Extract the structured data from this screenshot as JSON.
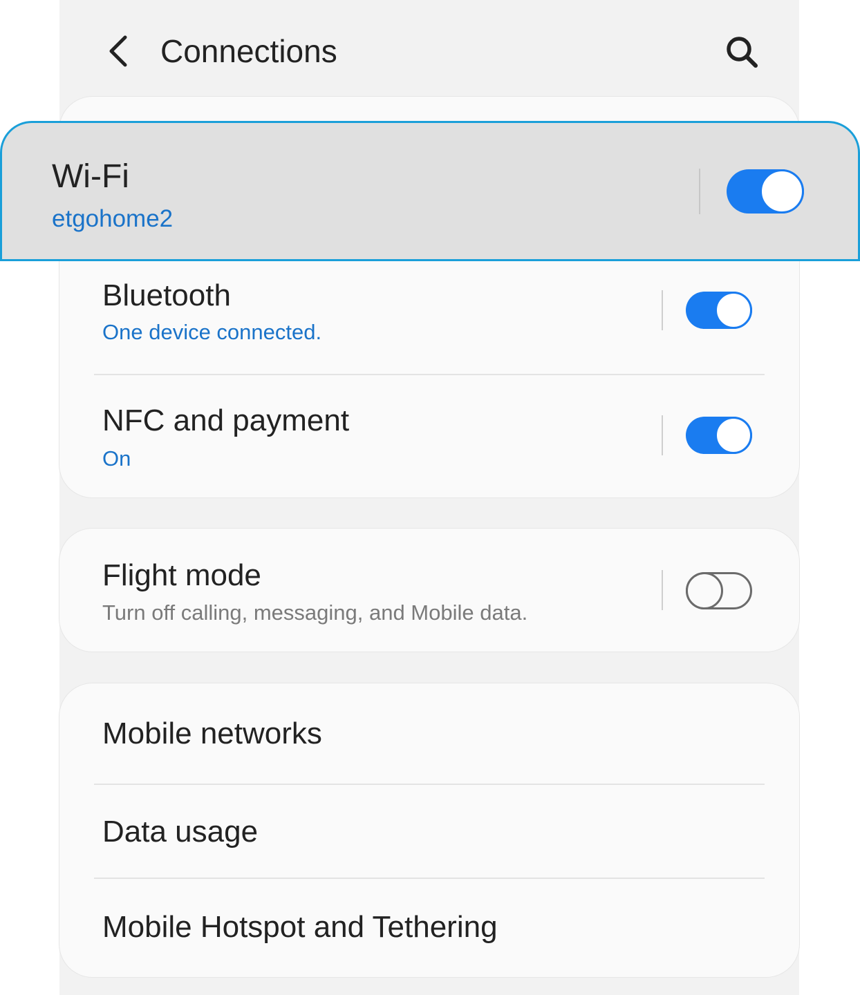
{
  "header": {
    "title": "Connections",
    "back_icon": "chevron-left-icon",
    "search_icon": "search-icon"
  },
  "connections": {
    "wifi": {
      "title": "Wi-Fi",
      "subtitle": "etgohome2",
      "enabled": true
    },
    "bluetooth": {
      "title": "Bluetooth",
      "subtitle": "One device connected.",
      "enabled": true
    },
    "nfc": {
      "title": "NFC and payment",
      "subtitle": "On",
      "enabled": true
    }
  },
  "flight_mode": {
    "title": "Flight mode",
    "subtitle": "Turn off calling, messaging, and Mobile data.",
    "enabled": false
  },
  "more": {
    "items": [
      {
        "label": "Mobile networks"
      },
      {
        "label": "Data usage"
      },
      {
        "label": "Mobile Hotspot and Tethering"
      }
    ]
  },
  "colors": {
    "accent": "#1a7cf0",
    "link_text": "#1a73c9",
    "highlight_border": "#1a9fd9",
    "background": "#f2f2f2",
    "card": "#fafafa"
  }
}
